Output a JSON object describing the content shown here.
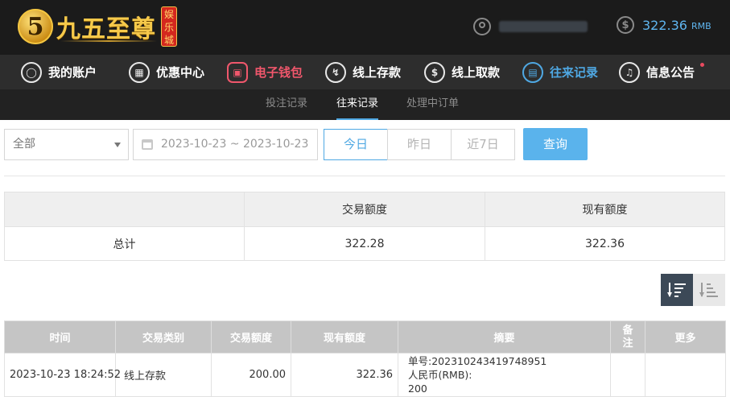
{
  "header": {
    "logo_text": "九五至尊",
    "logo_tag": "娱乐城",
    "balance_amount": "322.36",
    "balance_unit": "RMB"
  },
  "mainnav": {
    "items": [
      {
        "label": "我的账户",
        "icon": "user-icon"
      },
      {
        "label": "优惠中心",
        "icon": "gift-icon"
      },
      {
        "label": "电子钱包",
        "icon": "wallet-icon"
      },
      {
        "label": "线上存款",
        "icon": "deposit-icon"
      },
      {
        "label": "线上取款",
        "icon": "withdraw-icon"
      },
      {
        "label": "往来记录",
        "icon": "records-icon"
      },
      {
        "label": "信息公告",
        "icon": "bell-icon"
      }
    ]
  },
  "subnav": {
    "items": [
      {
        "label": "投注记录"
      },
      {
        "label": "往来记录"
      },
      {
        "label": "处理中订单"
      }
    ]
  },
  "filter": {
    "type_selected": "全部",
    "date_range": "2023-10-23 ~ 2023-10-23",
    "today": "今日",
    "yesterday": "昨日",
    "last7": "近7日",
    "query": "查询"
  },
  "summary": {
    "headers": [
      "",
      "交易额度",
      "现有额度"
    ],
    "row_label": "总计",
    "trade_amount": "322.28",
    "current_amount": "322.36"
  },
  "records": {
    "headers": [
      "时间",
      "交易类别",
      "交易额度",
      "现有额度",
      "摘要",
      "备注",
      "更多"
    ],
    "rows": [
      {
        "time": "2023-10-23 18:24:52",
        "type": "线上存款",
        "amount": "200.00",
        "balance": "322.36",
        "summary_line1": "单号:202310243419748951",
        "summary_line2": "人民币(RMB):",
        "summary_line3": "200",
        "note": "",
        "more": ""
      }
    ]
  },
  "colors": {
    "accent_blue": "#4fa8e3",
    "pink": "#f0576c",
    "header_bg": "#1b1b1b",
    "nav_bg": "#2d2d2d"
  }
}
